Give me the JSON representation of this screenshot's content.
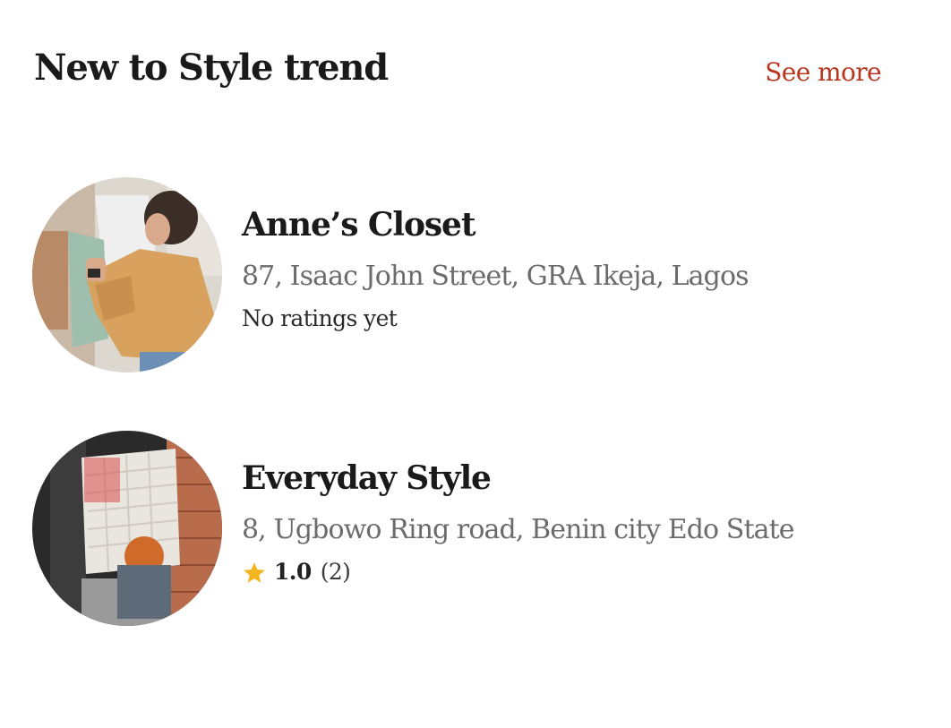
{
  "section": {
    "title": "New to Style trend",
    "see_more_label": "See more"
  },
  "stores": [
    {
      "name": "Anne’s Closet",
      "address": "87, Isaac John Street, GRA Ikeja, Lagos",
      "rating_text": "No ratings yet"
    },
    {
      "name": "Everyday Style",
      "address": "8, Ugbowo Ring road, Benin city Edo State",
      "rating_value": "1.0",
      "rating_count": "(2)",
      "rating_icon": "star-icon"
    }
  ],
  "colors": {
    "accent": "#b8361d",
    "star": "#f5b51f",
    "title": "#1a1a1a",
    "address": "#6b6b6b"
  }
}
